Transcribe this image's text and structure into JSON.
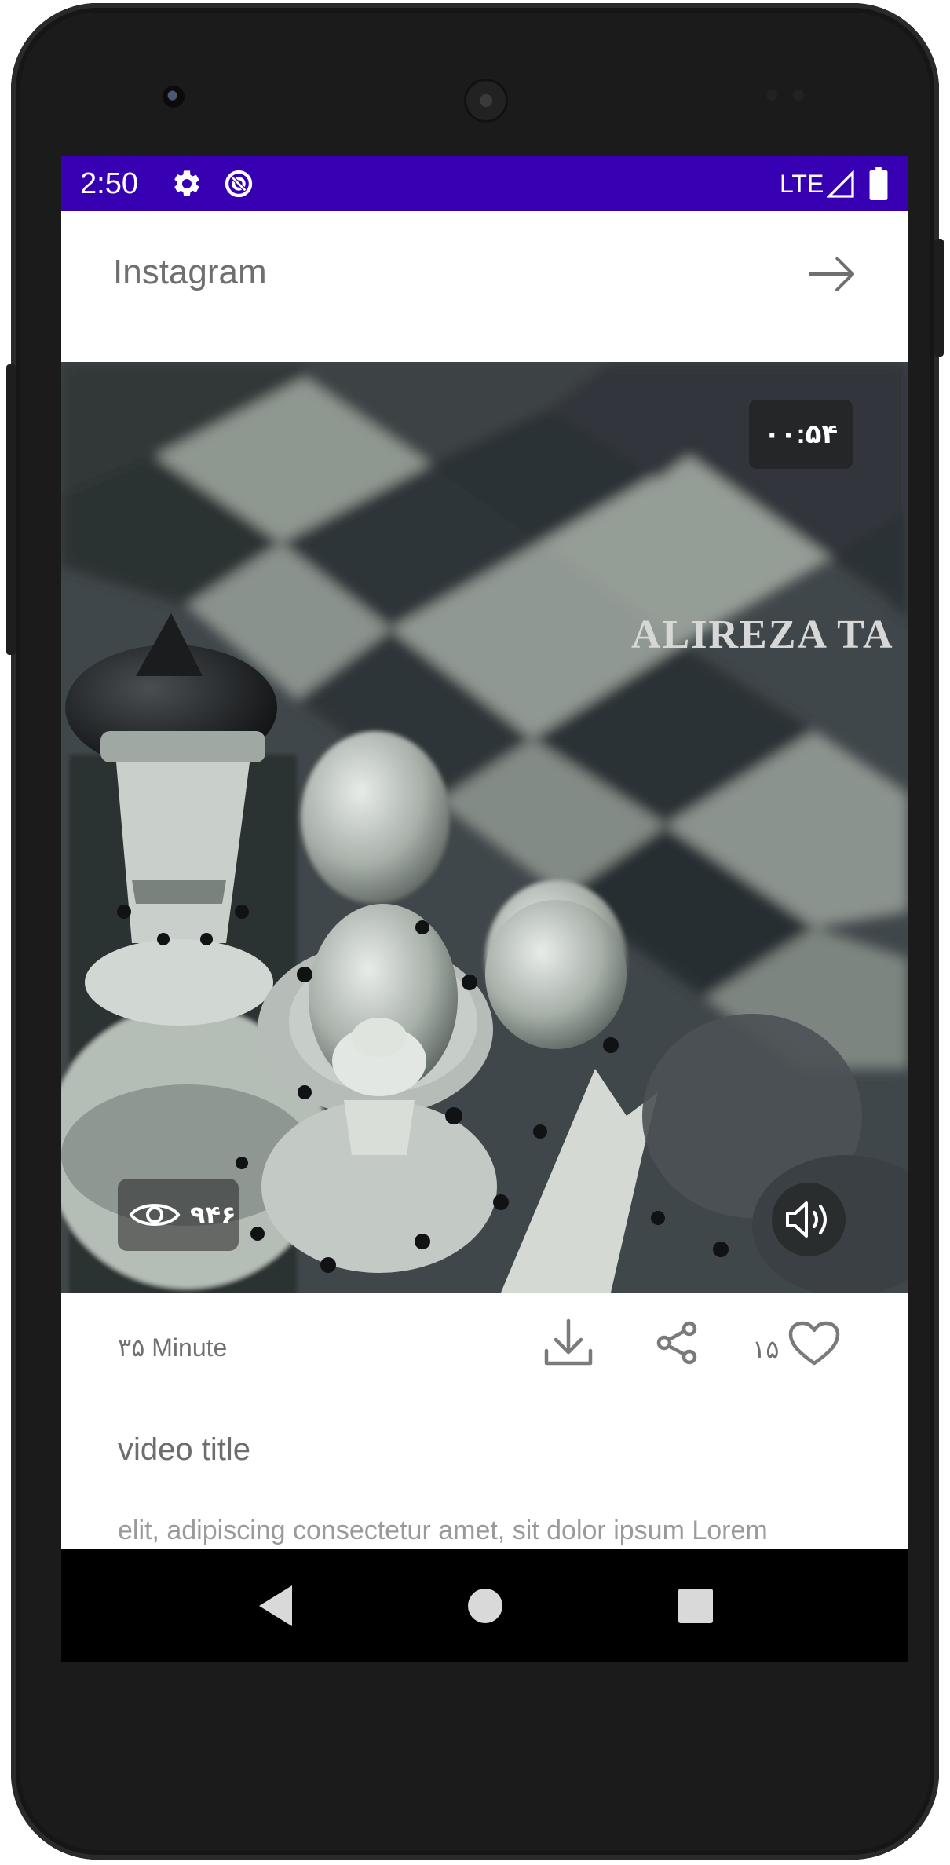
{
  "status_bar": {
    "time": "2:50",
    "network": "LTE",
    "icons": [
      "settings-icon",
      "data-saver-icon",
      "signal-icon",
      "battery-icon"
    ]
  },
  "app_bar": {
    "title": "Instagram",
    "action_icon": "arrow-right-icon"
  },
  "video": {
    "duration": "۰۰:۵۴",
    "overlay_text": "ALIREZA TA",
    "views": "۹۴۶",
    "views_icon": "eye-icon",
    "sound_icon": "volume-icon"
  },
  "post": {
    "duration_label": "۳۵ Minute",
    "likes": "۱۵",
    "actions": [
      "download-icon",
      "share-icon",
      "heart-icon"
    ],
    "title": "video title",
    "description": "elit, adipiscing consectetur amet, sit dolor ipsum Lorem"
  },
  "nav_bar": {
    "buttons": [
      "back-icon",
      "home-icon",
      "recents-icon"
    ]
  },
  "colors": {
    "status_bar": "#3700b3",
    "text_primary": "#6f6f6f",
    "text_secondary": "#9a9a9a",
    "device_body": "#1b1b1b"
  }
}
